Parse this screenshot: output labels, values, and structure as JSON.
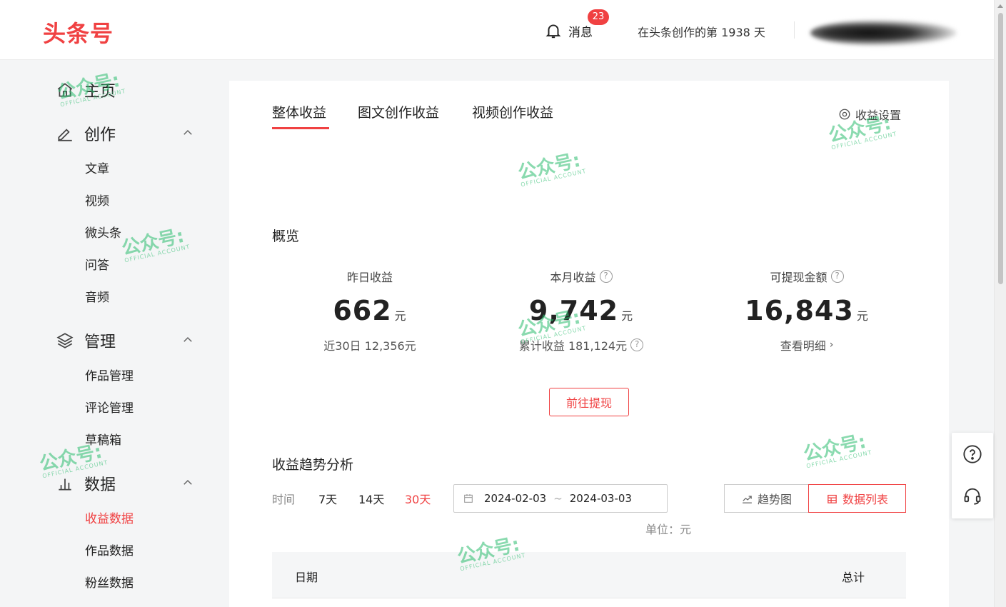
{
  "header": {
    "logo": "头条号",
    "messages_label": "消息",
    "messages_count": "23",
    "creation_days": "在头条创作的第 1938 天"
  },
  "sidebar": {
    "home": "主页",
    "create": "创作",
    "create_items": [
      "文章",
      "视频",
      "微头条",
      "问答",
      "音频"
    ],
    "manage": "管理",
    "manage_items": [
      "作品管理",
      "评论管理",
      "草稿箱"
    ],
    "data": "数据",
    "data_items": [
      "收益数据",
      "作品数据",
      "粉丝数据"
    ]
  },
  "tabs": [
    "整体收益",
    "图文创作收益",
    "视频创作收益"
  ],
  "settings_label": "收益设置",
  "overview": {
    "title": "概览",
    "stats": [
      {
        "label": "昨日收益",
        "value": "662",
        "unit": "元",
        "sub": "近30日 12,356元"
      },
      {
        "label": "本月收益",
        "value": "9,742",
        "unit": "元",
        "sub": "累计收益 181,124元"
      },
      {
        "label": "可提现金额",
        "value": "16,843",
        "unit": "元",
        "sub": "查看明细"
      }
    ],
    "withdraw_button": "前往提现"
  },
  "trend": {
    "title": "收益趋势分析",
    "time_label": "时间",
    "ranges": [
      "7天",
      "14天",
      "30天"
    ],
    "active_range": "30天",
    "date_start": "2024-02-03",
    "date_sep": "~",
    "date_end": "2024-03-03",
    "btn_trend": "趋势图",
    "btn_list": "数据列表",
    "unit": "单位：元",
    "columns": [
      "日期",
      "总计"
    ]
  },
  "watermark": {
    "text": "公众号:",
    "sub": "OFFICIAL ACCOUNT"
  },
  "colors": {
    "accent": "#f04142",
    "watermark": "#2bbd6e"
  }
}
